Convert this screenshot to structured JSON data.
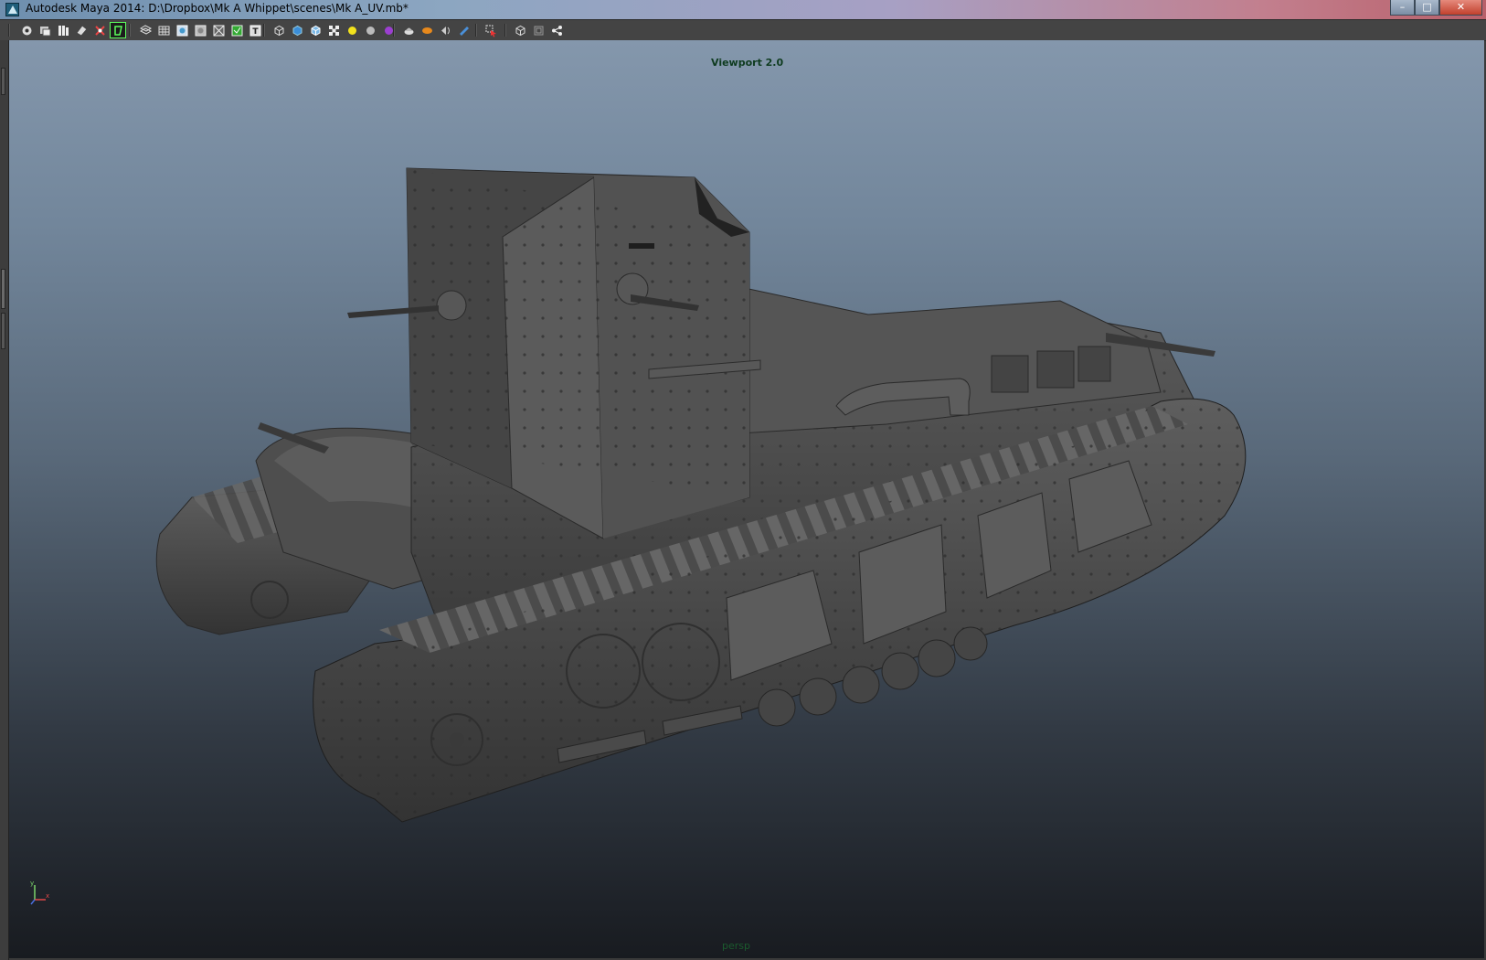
{
  "window": {
    "title": "Autodesk Maya 2014: D:\\Dropbox\\Mk A Whippet\\scenes\\Mk A_UV.mb*",
    "minimize": "–",
    "maximize": "□",
    "close": "✕"
  },
  "toolbar": {
    "groups": [
      [
        "camera-attributes-icon",
        "bookmarks-icon",
        "image-plane-icon",
        "view-previous-icon",
        "view-next-icon",
        "grid-toggle-icon"
      ],
      [
        "wireframe-icon",
        "smooth-shade-icon",
        "textured-icon",
        "lights-icon",
        "shadows-icon",
        "isolate-icon",
        "xray-icon"
      ],
      [
        "resolution-gate-icon",
        "film-gate-icon",
        "field-chart-icon",
        "safe-action-icon",
        "safe-title-icon"
      ],
      [
        "default-material-icon",
        "ambient-occlusion-icon",
        "motion-blur-icon",
        "anti-alias-icon"
      ],
      [
        "select-camera-icon",
        "frame-all-icon"
      ],
      [
        "panel-layout-icon",
        "film-back-icon",
        "share-icon"
      ]
    ]
  },
  "viewport": {
    "renderer_label": "Viewport 2.0",
    "camera_label": "persp",
    "axis": {
      "y": "y",
      "x": "x"
    },
    "colors": {
      "label_green": "#0e3b1f",
      "model_gray": "#4a4a4a"
    }
  }
}
